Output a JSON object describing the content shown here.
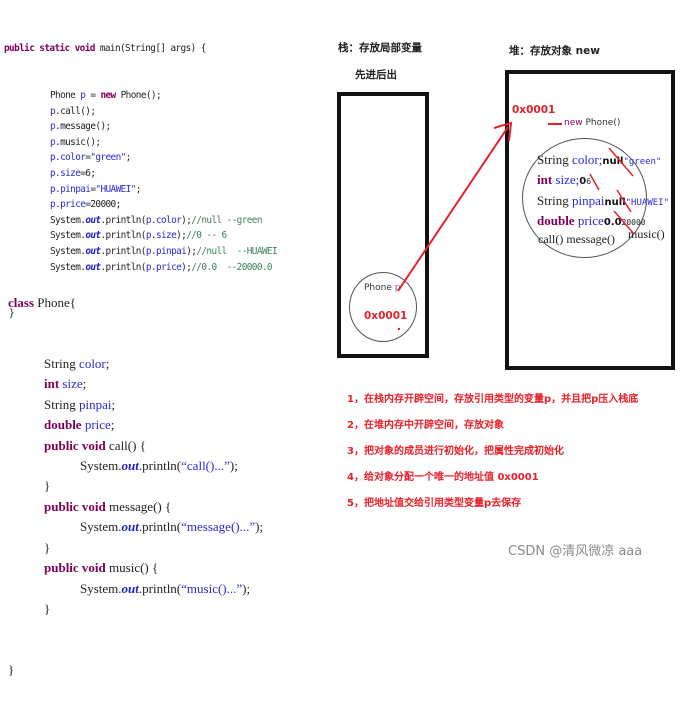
{
  "main_method": {
    "signature": {
      "kw": "public static void",
      "rest": " main(String[] args) {"
    },
    "lines": [
      {
        "parts": [
          [
            "",
            "Phone "
          ],
          [
            "fld",
            "p"
          ],
          [
            "",
            " = "
          ],
          [
            "kw",
            "new"
          ],
          [
            "",
            " Phone();"
          ]
        ]
      },
      {
        "parts": [
          [
            "fld",
            "p"
          ],
          [
            "",
            ".call();"
          ]
        ]
      },
      {
        "parts": [
          [
            "fld",
            "p"
          ],
          [
            "",
            ".message();"
          ]
        ]
      },
      {
        "parts": [
          [
            "fld",
            "p"
          ],
          [
            "",
            ".music();"
          ]
        ]
      },
      {
        "parts": [
          [
            "fld",
            "p.color"
          ],
          [
            "",
            "="
          ],
          [
            "str",
            "\"green\""
          ],
          [
            "",
            ";"
          ]
        ]
      },
      {
        "parts": [
          [
            "fld",
            "p.size"
          ],
          [
            "",
            "=6;"
          ]
        ]
      },
      {
        "parts": [
          [
            "fld",
            "p.pinpai"
          ],
          [
            "",
            "="
          ],
          [
            "str",
            "\"HUAWEI\""
          ],
          [
            "",
            ";"
          ]
        ]
      },
      {
        "parts": [
          [
            "fld",
            "p.price"
          ],
          [
            "",
            "=20000;"
          ]
        ]
      },
      {
        "parts": [
          [
            "",
            "System."
          ],
          [
            "st",
            "out"
          ],
          [
            "",
            ".println("
          ],
          [
            "fld",
            "p.color"
          ],
          [
            "",
            ");"
          ],
          [
            "cm",
            "//null --green"
          ]
        ]
      },
      {
        "parts": [
          [
            "",
            "System."
          ],
          [
            "st",
            "out"
          ],
          [
            "",
            ".println("
          ],
          [
            "fld",
            "p.size"
          ],
          [
            "",
            ");"
          ],
          [
            "cm",
            "//0 -- 6"
          ]
        ]
      },
      {
        "parts": [
          [
            "",
            "System."
          ],
          [
            "st",
            "out"
          ],
          [
            "",
            ".println("
          ],
          [
            "fld",
            "p.pinpai"
          ],
          [
            "",
            ");"
          ],
          [
            "cm",
            "//null  --HUAWEI"
          ]
        ]
      },
      {
        "parts": [
          [
            "",
            "System."
          ],
          [
            "st",
            "out"
          ],
          [
            "",
            ".println("
          ],
          [
            "fld",
            "p.price"
          ],
          [
            "",
            ");"
          ],
          [
            "cm",
            "//0.0  --20000.0"
          ]
        ]
      }
    ],
    "closing": "}"
  },
  "phone_class": {
    "header": {
      "kw": "class",
      "rest": " Phone{"
    },
    "fields": [
      {
        "type": "String",
        "type_kw": false,
        "name": "color"
      },
      {
        "type": "int",
        "type_kw": true,
        "name": "size"
      },
      {
        "type": "String",
        "type_kw": false,
        "name": "pinpai"
      },
      {
        "type": "double",
        "type_kw": true,
        "name": "price"
      }
    ],
    "methods": [
      {
        "decl_kw": "public void",
        "decl_rest": " call() {",
        "body_pre": "System.",
        "body_out": "out",
        "body_mid": ".println(",
        "body_str": "“call()...”",
        "body_end": ");",
        "close": "}"
      },
      {
        "decl_kw": "public void",
        "decl_rest": " message() {",
        "body_pre": "System.",
        "body_out": "out",
        "body_mid": ".println(",
        "body_str": "“message()...”",
        "body_end": ");",
        "close": "}"
      },
      {
        "decl_kw": "public void",
        "decl_rest": " music() {",
        "body_pre": "System.",
        "body_out": "out",
        "body_mid": ".println(",
        "body_str": "“music()...”",
        "body_end": ");",
        "close": "}"
      }
    ],
    "closing": "}"
  },
  "stack": {
    "title": "栈：存放局部变量",
    "subtitle": "先进后出",
    "var_type": "Phone",
    "var_name": "p",
    "address": "0x0001"
  },
  "heap": {
    "title": "堆：存放对象 new",
    "address": "0x0001",
    "new_kw": "new",
    "new_rest": " Phone()",
    "fields": [
      {
        "type": "String",
        "type_kw": false,
        "name": "color;",
        "default": "null",
        "value": "\"green\""
      },
      {
        "type": "int",
        "type_kw": true,
        "name": "size;",
        "default": "0",
        "value": "6"
      },
      {
        "type": "String",
        "type_kw": false,
        "name": "pinpai",
        "default": "null",
        "value": "\"HUAWEI\""
      },
      {
        "type": "double",
        "type_kw": true,
        "name": "price",
        "default": "0.0",
        "value": "20000"
      }
    ],
    "methods_line": "call() message()",
    "methods_extra": "music()"
  },
  "steps": [
    "1，在栈内存开辟空间，存放引用类型的变量p，并且把p压入栈底",
    "2，在堆内存中开辟空间，存放对象",
    "3，把对象的成员进行初始化，把属性完成初始化",
    "4，给对象分配一个唯一的地址值 0x0001",
    "5，把地址值交给引用类型变量p去保存"
  ],
  "colors": {
    "keyword": "#7f0055",
    "field": "#2a2ad8",
    "comment": "#3f7f5f",
    "annotation_red": "#e8202a"
  },
  "watermark": "CSDN @清风微凉 aaa"
}
